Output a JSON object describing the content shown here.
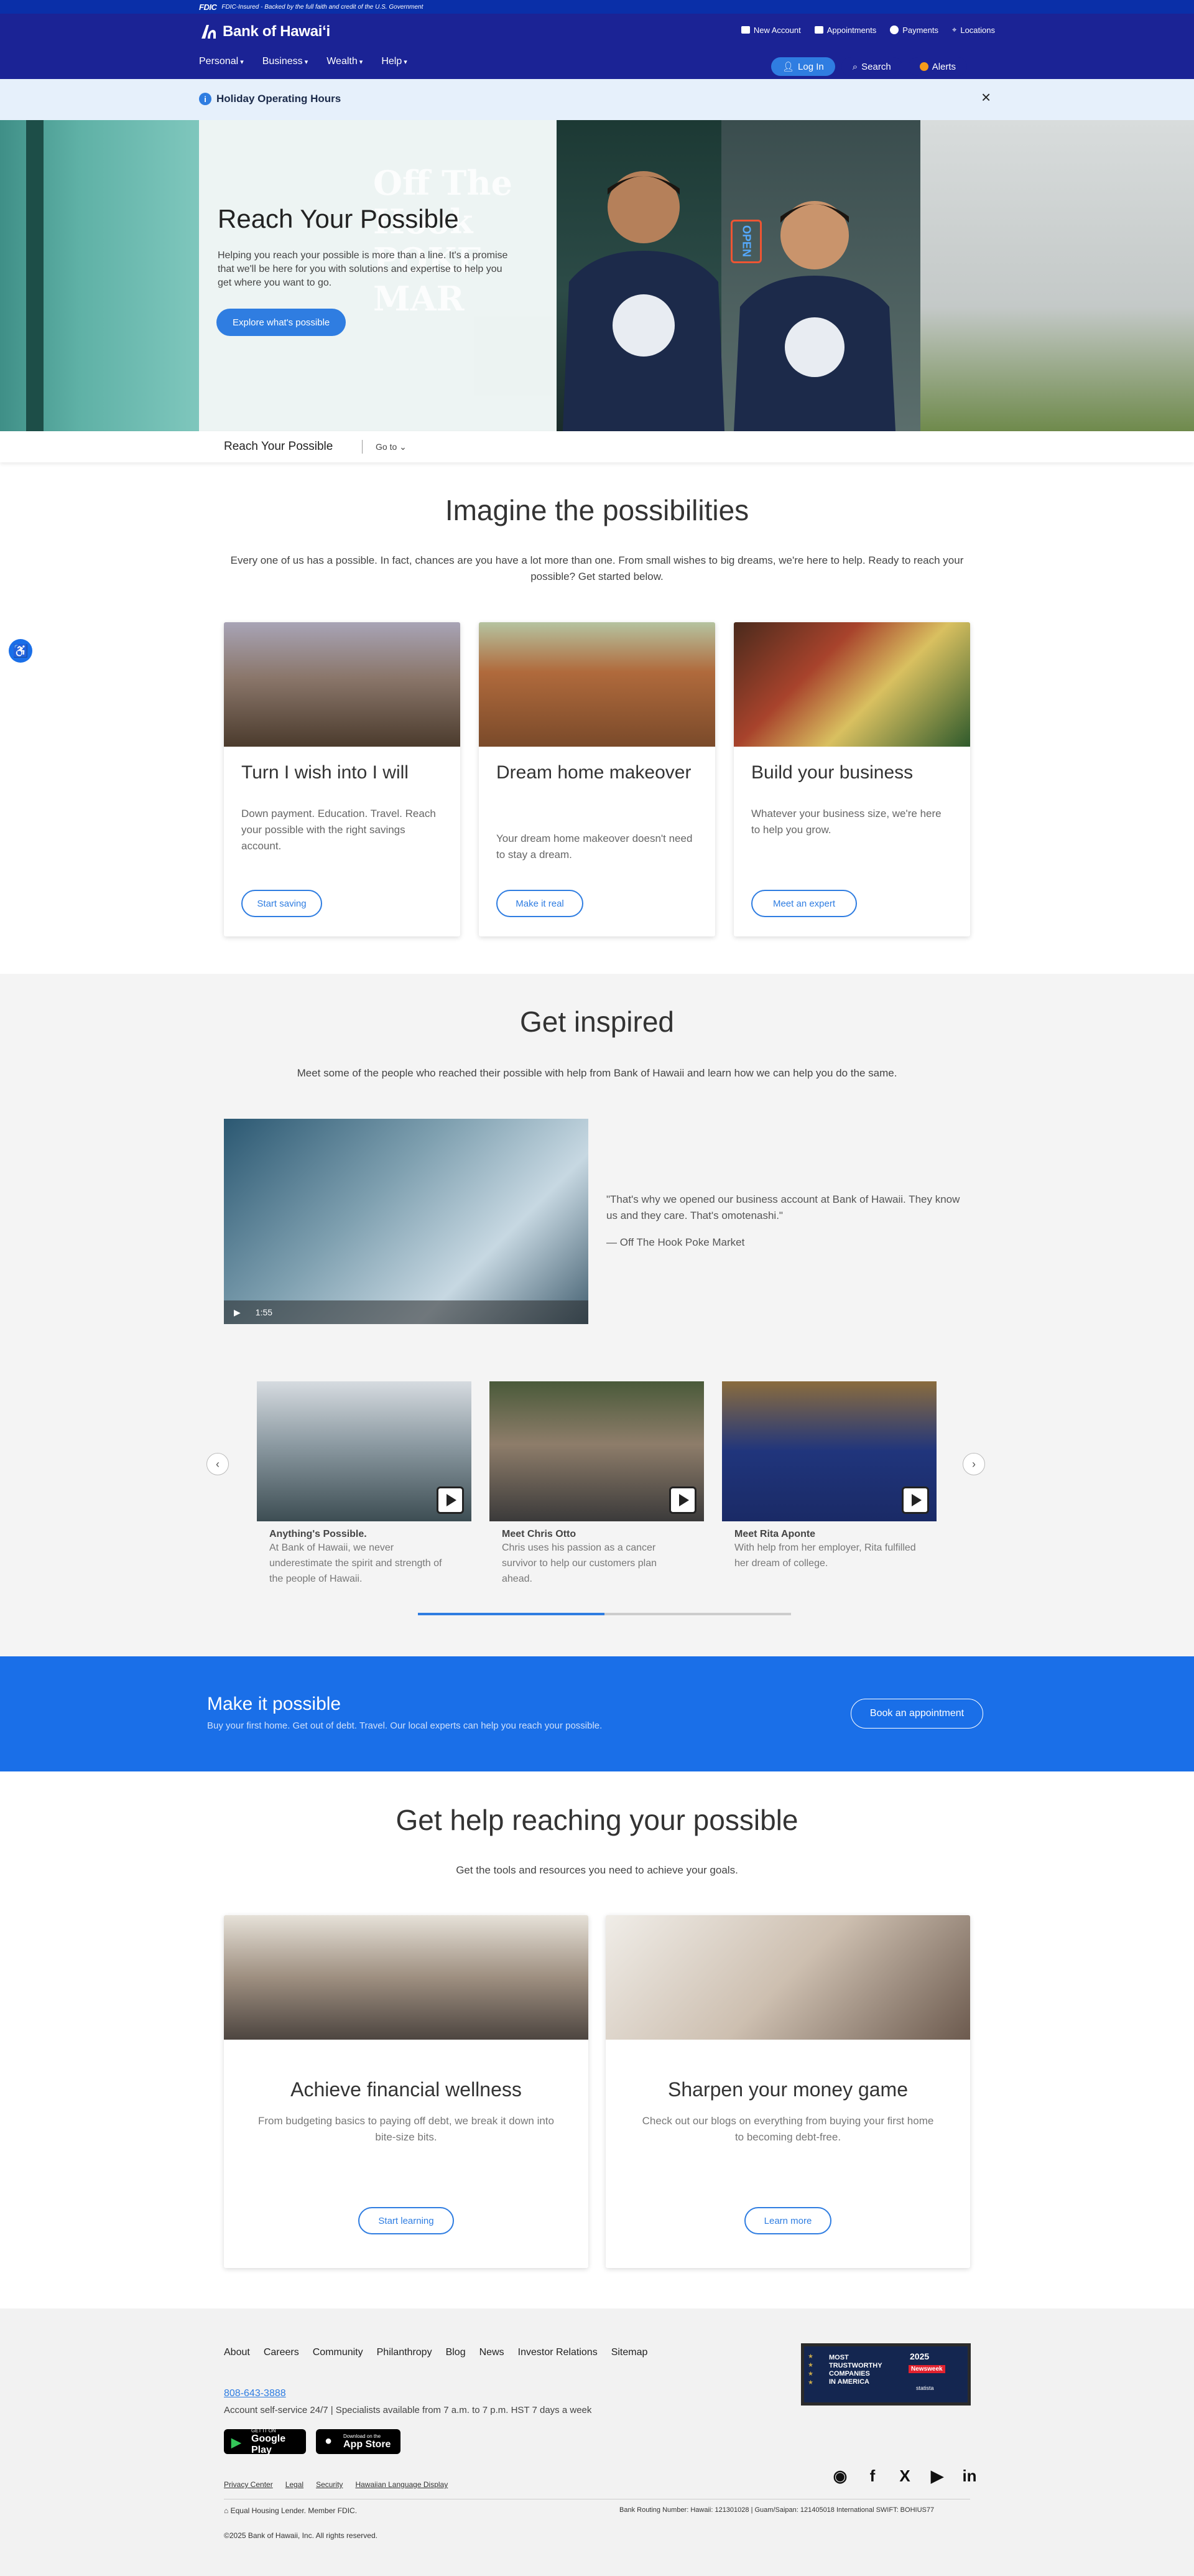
{
  "fdic": {
    "logo": "FDIC",
    "text": "FDIC-Insured - Backed by the full faith and credit of the U.S. Government"
  },
  "header": {
    "logo_text": "Bank of Hawaiʻi",
    "utility": [
      {
        "label": "New Account",
        "icon": "account-icon"
      },
      {
        "label": "Appointments",
        "icon": "calendar-icon"
      },
      {
        "label": "Payments",
        "icon": "dollar-icon"
      },
      {
        "label": "Locations",
        "icon": "location-pin-icon"
      }
    ],
    "nav": [
      "Personal",
      "Business",
      "Wealth",
      "Help"
    ],
    "login_label": "Log In",
    "search_label": "Search",
    "alerts_label": "Alerts"
  },
  "holiday": {
    "title": "Holiday Operating Hours",
    "close": "×"
  },
  "hero": {
    "title": "Reach Your Possible",
    "text": "Helping you reach your possible is more than a line. It's a promise that we'll be here for you with solutions and expertise to help you get where you want to go.",
    "cta": "Explore what's possible",
    "sign_text": "Off The Hook POKE MAR",
    "open_sign": "OPEN",
    "shirt_logo": "Off The Hook"
  },
  "subnav": {
    "title": "Reach Your Possible",
    "goto": "Go to"
  },
  "imagine": {
    "title": "Imagine the possibilities",
    "lead": "Every one of us has a possible. In fact, chances are you have a lot more than one. From small wishes to big dreams, we're here to help. Ready to reach your possible? Get started below.",
    "cards": [
      {
        "title": "Turn I wish into I will",
        "desc": "Down payment. Education. Travel. Reach your possible with the right savings account.",
        "button": "Start saving"
      },
      {
        "title": "Dream home makeover",
        "desc": "Your dream home makeover doesn't need to stay a dream.",
        "button": "Make it real"
      },
      {
        "title": "Build your business",
        "desc": "Whatever your business size, we're here to help you grow.",
        "button": "Meet an expert"
      }
    ]
  },
  "inspired": {
    "title": "Get inspired",
    "lead": "Meet some of the people who reached their possible with help from Bank of Hawaii and learn how we can help you do the same.",
    "video_duration": "1:55",
    "quote": "\"That's why we opened our business account at Bank of Hawaii. They know us and they care. That's omotenashi.\"",
    "quote_source": "— Off The Hook Poke Market",
    "videos": [
      {
        "title": "Anything's Possible.",
        "desc": "At Bank of Hawaii, we never underestimate the spirit and strength of the people of Hawaii."
      },
      {
        "title": "Meet Chris Otto",
        "desc": "Chris uses his passion as a cancer survivor to help our customers plan ahead."
      },
      {
        "title": "Meet Rita Aponte",
        "desc": "With help from her employer, Rita fulfilled her dream of college."
      }
    ],
    "carousel_progress": 0.5
  },
  "make_possible": {
    "title": "Make it possible",
    "text": "Buy your first home. Get out of debt. Travel. Our local experts can help you reach your possible.",
    "button": "Book an appointment"
  },
  "help": {
    "title": "Get help reaching your possible",
    "lead": "Get the tools and resources you need to achieve your goals.",
    "cards": [
      {
        "title": "Achieve financial wellness",
        "desc": "From budgeting basics to paying off debt, we break it down into bite-size bits.",
        "button": "Start learning"
      },
      {
        "title": "Sharpen your money game",
        "desc": "Check out our blogs on everything from buying your first home to becoming debt-free.",
        "button": "Learn more"
      }
    ]
  },
  "footer": {
    "links": [
      "About",
      "Careers",
      "Community",
      "Philanthropy",
      "Blog",
      "News",
      "Investor Relations",
      "Sitemap"
    ],
    "phone": "808-643-3888",
    "self_service": "Account self-service 24/7  |  Specialists available from 7 a.m. to 7 p.m. HST 7 days a week",
    "google_play_small": "GET IT ON",
    "google_play": "Google Play",
    "app_store_small": "Download on the",
    "app_store": "App Store",
    "badge": {
      "line1": "MOST",
      "line2": "TRUSTWORTHY",
      "line3": "COMPANIES",
      "line4": "IN AMERICA",
      "year": "2025",
      "brand": "Newsweek",
      "partner": "statista"
    },
    "legal": [
      "Privacy Center",
      "Legal",
      "Security",
      "Hawaiian Language Display"
    ],
    "ehl": "Equal Housing Lender. Member FDIC.",
    "routing": "Bank Routing Number: Hawaii: 121301028  |  Guam/Saipan: 121405018  International SWIFT: BOHIUS77",
    "copyright": "©2025 Bank of Hawaii, Inc. All rights reserved."
  },
  "colors": {
    "brand_navy": "#1b2395",
    "accent_blue": "#2f7de1",
    "banner_blue": "#1a6fe8"
  }
}
